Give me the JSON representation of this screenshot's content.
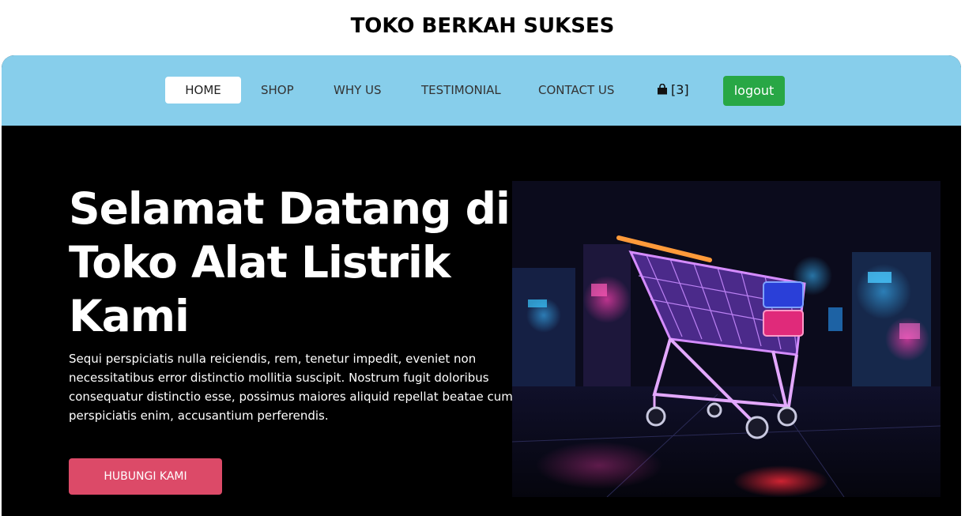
{
  "site": {
    "title": "TOKO BERKAH SUKSES"
  },
  "nav": {
    "items": [
      {
        "label": "HOME"
      },
      {
        "label": "SHOP"
      },
      {
        "label": "WHY US"
      },
      {
        "label": "TESTIMONIAL"
      },
      {
        "label": "CONTACT US"
      }
    ],
    "cart_count": "[3]",
    "cart_icon": "shopping-bag-icon",
    "logout_label": "logout"
  },
  "hero": {
    "title": "Selamat Datang di Toko Alat Listrik Kami",
    "text": "Sequi perspiciatis nulla reiciendis, rem, tenetur impedit, eveniet non necessitatibus error distinctio mollitia suscipit. Nostrum fugit doloribus consequatur distinctio esse, possimus maiores aliquid repellat beatae cum, perspiciatis enim, accusantium perferendis.",
    "button_label": "HUBUNGI KAMI",
    "image": "neon-shopping-cart-image"
  },
  "colors": {
    "navbar": "#87ceeb",
    "logout": "#28a745",
    "cta": "#dc4a68",
    "hero_bg": "#000000"
  }
}
